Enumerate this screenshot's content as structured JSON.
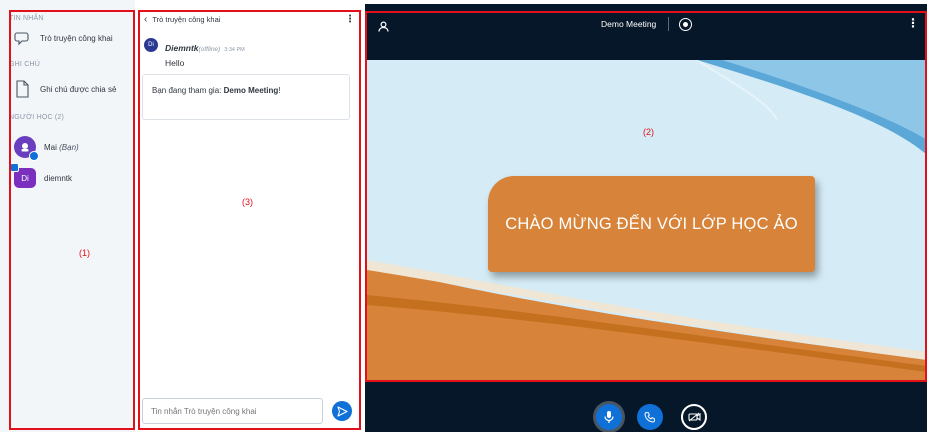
{
  "sidebar": {
    "messages_title": "TIN NHẮN",
    "public_chat_label": "Trò truyện công khai",
    "notes_title": "GHI CHÚ",
    "shared_notes_label": "Ghi chú được chia sẻ",
    "users_title": "NGƯỜI HỌC (2)",
    "users": [
      {
        "name": "Mai",
        "suffix": "(Bạn)",
        "avatar_text": ""
      },
      {
        "name": "diemntk",
        "suffix": "",
        "avatar_text": "Di"
      }
    ],
    "region_label": "(1)"
  },
  "chat": {
    "header_title": "Trò truyện công khai",
    "message": {
      "avatar_text": "Di",
      "author": "Diemntk",
      "status": "(offline)",
      "time": "3:34 PM",
      "text": "Hello"
    },
    "welcome_prefix": "Bạn đang tham gia:",
    "welcome_meeting": "Demo Meeting",
    "welcome_suffix": "!",
    "region_label": "(3)",
    "input_placeholder": "Tin nhắn Trò truyện công khai"
  },
  "meeting": {
    "title": "Demo Meeting",
    "region_label": "(2)",
    "slide_text": "CHÀO MỪNG ĐẾN VỚI LỚP HỌC ẢO"
  },
  "colors": {
    "accent": "#0f70d7",
    "annotation_red": "#e1101a",
    "slide_orange": "#d8833a",
    "meeting_bg": "#06172a"
  }
}
